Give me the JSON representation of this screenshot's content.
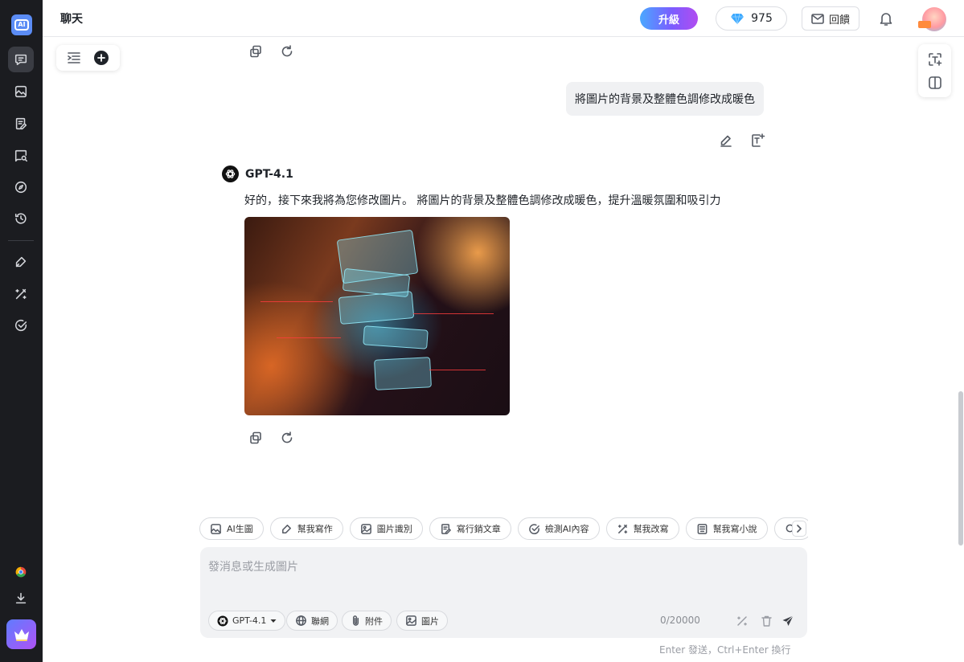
{
  "topbar": {
    "title": "聊天",
    "upgrade_label": "升級",
    "gems_count": "975",
    "feedback_label": "回饋"
  },
  "conversation": {
    "user_message": "將圖片的背景及整體色調修改成暖色",
    "model_name": "GPT-4.1",
    "reply_text": "好的，接下來我將為您修改圖片。 將圖片的背景及整體色調修改成暖色，提升溫暖氛圍和吸引力"
  },
  "quick_actions": [
    {
      "label": "AI生圖",
      "icon": "image-icon"
    },
    {
      "label": "幫我寫作",
      "icon": "pen-icon"
    },
    {
      "label": "圖片識別",
      "icon": "image-scan-icon"
    },
    {
      "label": "寫行銷文章",
      "icon": "document-edit-icon"
    },
    {
      "label": "檢測AI內容",
      "icon": "check-circle-icon"
    },
    {
      "label": "幫我改寫",
      "icon": "magic-wand-icon"
    },
    {
      "label": "幫我寫小說",
      "icon": "book-icon"
    },
    {
      "label": "",
      "icon": "search-icon"
    }
  ],
  "composer": {
    "placeholder": "發消息或生成圖片",
    "model_select": "GPT-4.1",
    "web_label": "聯網",
    "attach_label": "附件",
    "image_label": "圖片",
    "char_count": "0/20000",
    "hint": "Enter 發送，Ctrl+Enter 換行"
  },
  "colors": {
    "sidebar_bg": "#1b1c20",
    "upgrade_gradient_start": "#4aa8ff",
    "upgrade_gradient_end": "#b14cf0",
    "user_bubble_bg": "#f0f1f3",
    "composer_bg": "#f1f2f4",
    "gem_blue": "#3aa8ff"
  }
}
